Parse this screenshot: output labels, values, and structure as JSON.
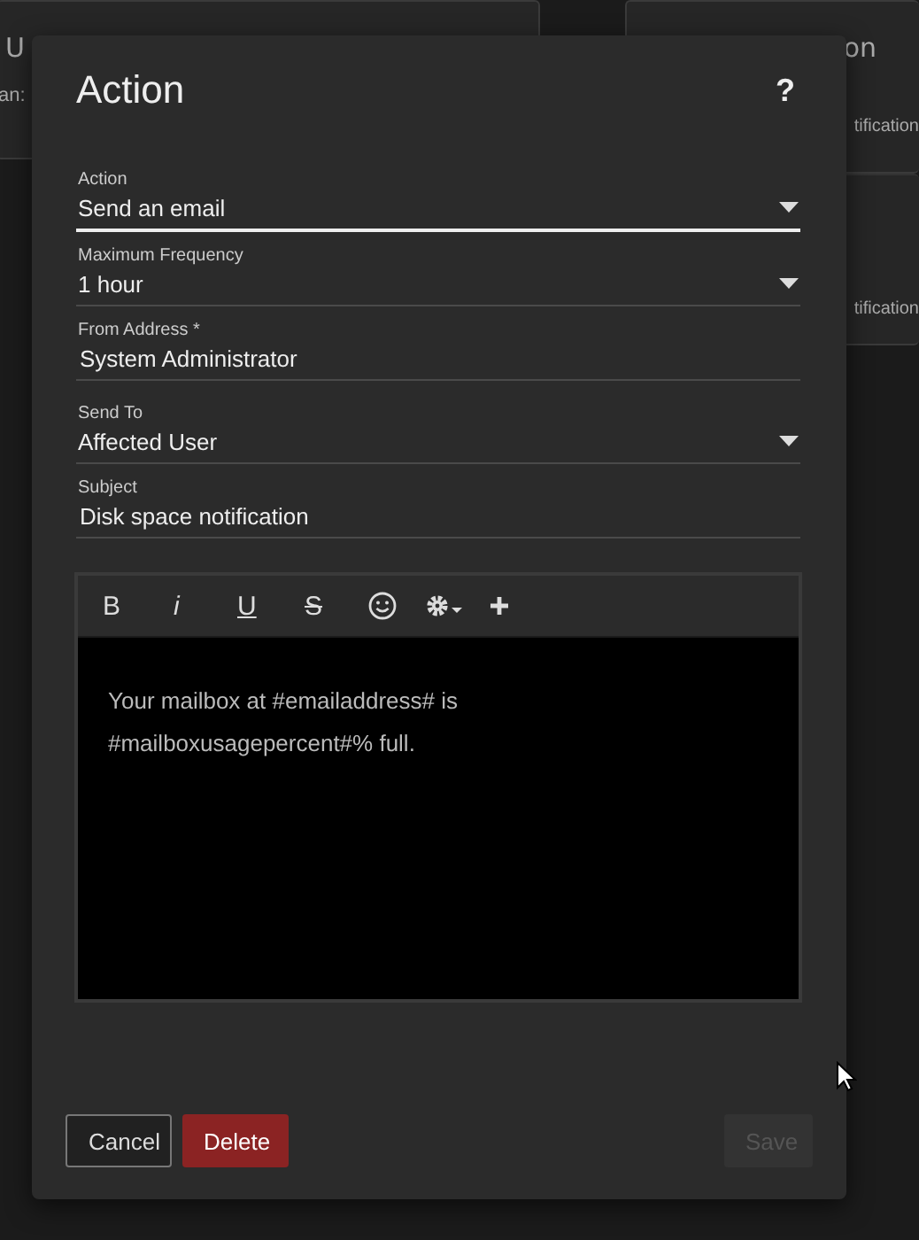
{
  "background_cards": [
    {
      "title": "U",
      "detail": "an:"
    },
    {
      "title": "on",
      "detail": "tification"
    },
    {
      "detail": "tification"
    }
  ],
  "dialog": {
    "title": "Action",
    "help": "?",
    "fields": [
      {
        "kind": "select",
        "label": "Action",
        "value": "Send an email",
        "focused": true
      },
      {
        "kind": "select",
        "label": "Maximum Frequency",
        "value": "1 hour",
        "focused": false
      },
      {
        "kind": "text",
        "label": "From Address *",
        "value": "System Administrator",
        "focused": false
      },
      {
        "kind": "select",
        "label": "Send To",
        "value": "Affected User",
        "focused": false
      },
      {
        "kind": "text",
        "label": "Subject",
        "value": "Disk space notification",
        "focused": false
      }
    ],
    "editor": {
      "toolbar": [
        {
          "kind": "bold",
          "label": "B"
        },
        {
          "kind": "italic",
          "label": "i"
        },
        {
          "kind": "underline",
          "label": "U"
        },
        {
          "kind": "strike",
          "label": "S"
        },
        {
          "kind": "emoji"
        },
        {
          "kind": "gear"
        },
        {
          "kind": "plus"
        }
      ],
      "body": "Your mailbox at #emailaddress# is #mailboxusagepercent#% full."
    },
    "buttons": [
      {
        "kind": "cancel",
        "label": "Cancel",
        "disabled": false
      },
      {
        "kind": "delete",
        "label": "Delete",
        "disabled": false
      },
      {
        "kind": "save",
        "label": "Save",
        "disabled": true
      }
    ]
  }
}
